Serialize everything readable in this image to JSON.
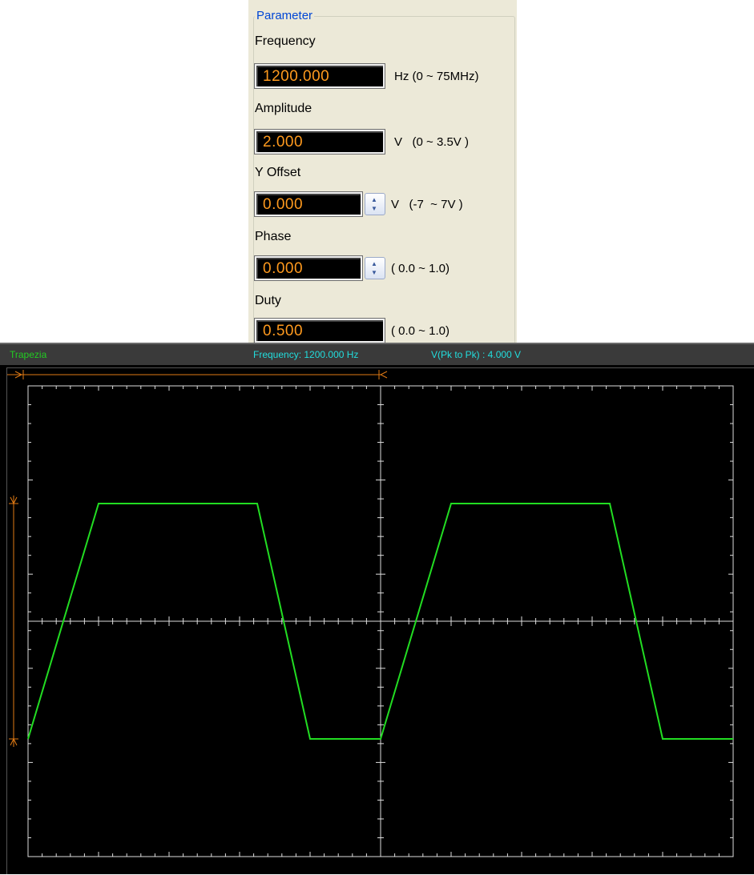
{
  "panel": {
    "legend": "Parameter",
    "fields": [
      {
        "label": "Frequency",
        "value": "1200.000",
        "range": "Hz (0 ~ 75MHz)",
        "spinner": false
      },
      {
        "label": "Amplitude",
        "value": "2.000",
        "range": "V   (0 ~ 3.5V )",
        "spinner": false
      },
      {
        "label": "Y Offset",
        "value": "0.000",
        "range": "V   (-7  ~ 7V )",
        "spinner": true
      },
      {
        "label": "Phase",
        "value": "0.000",
        "range": "( 0.0 ~ 1.0)",
        "spinner": true
      },
      {
        "label": "Duty",
        "value": "0.500",
        "range": "( 0.0 ~ 1.0)",
        "spinner": false
      }
    ]
  },
  "scope": {
    "waveform_name": "Trapezia",
    "frequency_text": "Frequency: 1200.000 Hz",
    "vpp_text": "V(Pk to Pk) : 4.000 V",
    "colors": {
      "trace": "#22dd22",
      "grid": "#dddddd",
      "marker": "#e07a14",
      "value": "#ff9a1e",
      "header_name": "#22cc22",
      "header_info": "#22dddd"
    }
  },
  "chart_data": {
    "type": "line",
    "x": [
      0,
      0.2,
      0.25,
      0.65,
      0.8,
      1.0,
      1.2,
      1.25,
      1.65,
      1.8,
      2.0
    ],
    "y": [
      -1,
      1,
      1,
      1,
      -1,
      -1,
      1,
      1,
      1,
      -1,
      -1
    ],
    "series": [
      {
        "values": [
          -1,
          1,
          1,
          1,
          -1,
          -1,
          1,
          1,
          1,
          -1,
          -1
        ]
      }
    ],
    "xlim": [
      0,
      2
    ],
    "ylim": [
      -2,
      2
    ],
    "grid": true
  }
}
